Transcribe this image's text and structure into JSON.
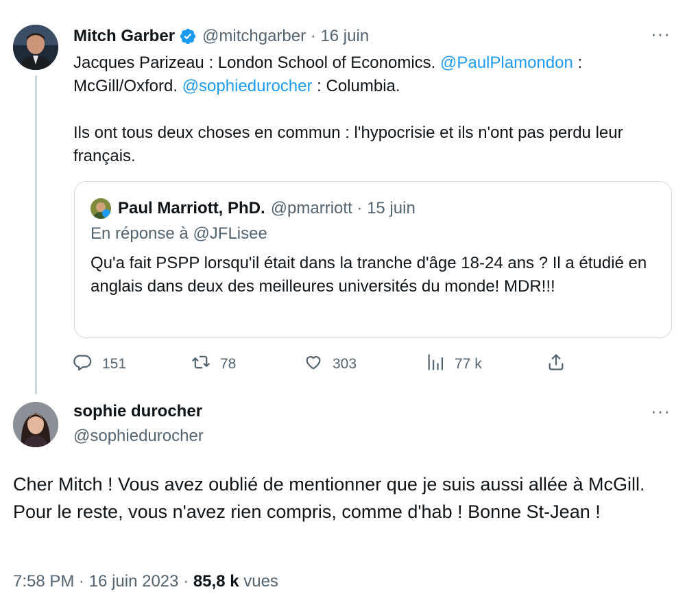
{
  "tweet1": {
    "name": "Mitch Garber",
    "handle_date": "@mitchgarber · 16 juin",
    "more": "···",
    "line1_a": "Jacques Parizeau : London School of Economics. ",
    "mention1": "@PaulPlamondon",
    "line1_b": " : McGill/Oxford. ",
    "mention2": "@sophiedurocher",
    "line1_c": " : Columbia.",
    "para2": "Ils ont tous deux choses en commun : l'hypocrisie et ils n'ont pas perdu leur français.",
    "quote": {
      "name": "Paul Marriott, PhD.",
      "handle_date": "@pmarriott · 15 juin",
      "reply_to": "En réponse à @JFLisee",
      "text": "Qu'a fait PSPP lorsqu'il était dans la tranche d'âge 18-24 ans ? Il a étudié en anglais dans deux des meilleures universités du monde! MDR!!!"
    },
    "actions": {
      "replies": "151",
      "retweets": "78",
      "likes": "303",
      "views": "77 k"
    }
  },
  "tweet2": {
    "name": "sophie durocher",
    "handle": "@sophiedurocher",
    "more": "···",
    "text": "Cher Mitch ! Vous avez oublié de mentionner que je suis aussi allée à McGill. Pour le reste, vous n'avez rien compris, comme d'hab ! Bonne St-Jean !",
    "time": "7:58 PM · 16 juin 2023 · ",
    "views_count": "85,8 k",
    "views_label": " vues"
  },
  "icons": {
    "verified": "verified-badge-icon",
    "reply": "reply-icon",
    "retweet": "retweet-icon",
    "like": "heart-icon",
    "views": "views-chart-icon",
    "share": "share-icon",
    "more": "more-dots-icon"
  },
  "colors": {
    "accent": "#1d9bf0",
    "secondary_text": "#536471",
    "primary_text": "#0f1419",
    "border": "#cfd9de"
  }
}
